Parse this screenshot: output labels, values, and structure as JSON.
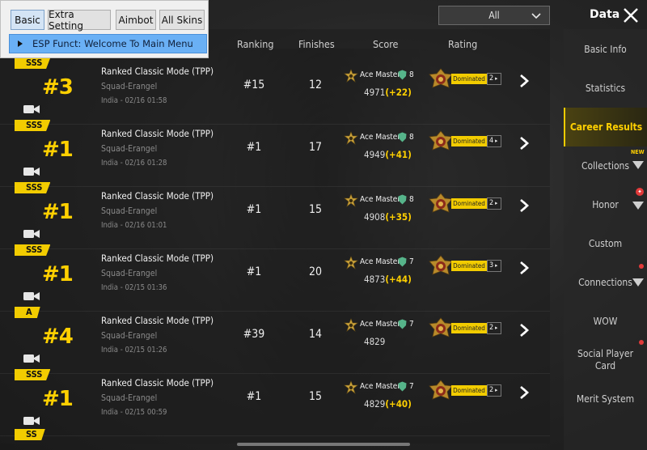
{
  "esp_menu": {
    "tabs": [
      "Basic",
      "Extra Setting",
      "Aimbot",
      "All Skins"
    ],
    "active_tab": "Basic",
    "item": "ESP Funct: Welcome To Main Menu"
  },
  "header": {
    "dropdown_value": "All",
    "title": "Data"
  },
  "columns": {
    "ranking": "Ranking",
    "finishes": "Finishes",
    "score": "Score",
    "rating": "Rating"
  },
  "rows": [
    {
      "tier": "SSS",
      "rank_big": "#3",
      "mode": "Ranked Classic Mode (TPP)",
      "map": "Squad-Erangel",
      "datetime": "India - 02/16 01:58",
      "ranking": "#15",
      "finishes": "12",
      "tier_name": "Ace Master",
      "level": "8",
      "score": "4971",
      "delta": "(+22)",
      "rating_label": "Dominated",
      "rating_count": "2"
    },
    {
      "tier": "SSS",
      "rank_big": "#1",
      "mode": "Ranked Classic Mode (TPP)",
      "map": "Squad-Erangel",
      "datetime": "India - 02/16 01:28",
      "ranking": "#1",
      "finishes": "17",
      "tier_name": "Ace Master",
      "level": "8",
      "score": "4949",
      "delta": "(+41)",
      "rating_label": "Dominated",
      "rating_count": "4"
    },
    {
      "tier": "SSS",
      "rank_big": "#1",
      "mode": "Ranked Classic Mode (TPP)",
      "map": "Squad-Erangel",
      "datetime": "India - 02/16 01:01",
      "ranking": "#1",
      "finishes": "15",
      "tier_name": "Ace Master",
      "level": "8",
      "score": "4908",
      "delta": "(+35)",
      "rating_label": "Dominated",
      "rating_count": "2"
    },
    {
      "tier": "SSS",
      "rank_big": "#1",
      "mode": "Ranked Classic Mode (TPP)",
      "map": "Squad-Erangel",
      "datetime": "India - 02/15 01:36",
      "ranking": "#1",
      "finishes": "20",
      "tier_name": "Ace Master",
      "level": "7",
      "score": "4873",
      "delta": "(+44)",
      "rating_label": "Dominated",
      "rating_count": "3"
    },
    {
      "tier": "A",
      "rank_big": "#4",
      "mode": "Ranked Classic Mode (TPP)",
      "map": "Squad-Erangel",
      "datetime": "India - 02/15 01:26",
      "ranking": "#39",
      "finishes": "14",
      "tier_name": "Ace Master",
      "level": "7",
      "score": "4829",
      "delta": "",
      "rating_label": "Dominated",
      "rating_count": "2"
    },
    {
      "tier": "SSS",
      "rank_big": "#1",
      "mode": "Ranked Classic Mode (TPP)",
      "map": "Squad-Erangel",
      "datetime": "India - 02/15 00:59",
      "ranking": "#1",
      "finishes": "15",
      "tier_name": "Ace Master",
      "level": "7",
      "score": "4829",
      "delta": "(+40)",
      "rating_label": "Dominated",
      "rating_count": "2"
    }
  ],
  "next_row_tier": "SS",
  "sidebar": {
    "items": [
      "Basic Info",
      "Statistics",
      "Career Results",
      "Collections",
      "Honor",
      "Custom",
      "Connections",
      "WOW",
      "Social Player Card",
      "Merit System"
    ],
    "active": "Career Results",
    "new_badge": "NEW"
  },
  "colors": {
    "accent": "#f2cc00",
    "rank_text": "#ffd000",
    "esp_selected": "#6ab0f5",
    "background": "#262626"
  },
  "icons": {
    "camera": "video-camera-icon",
    "chevron": "chevron-right-icon",
    "close": "close-icon",
    "tier": "ace-master-tier-icon",
    "medal": "dominated-medal-icon"
  }
}
